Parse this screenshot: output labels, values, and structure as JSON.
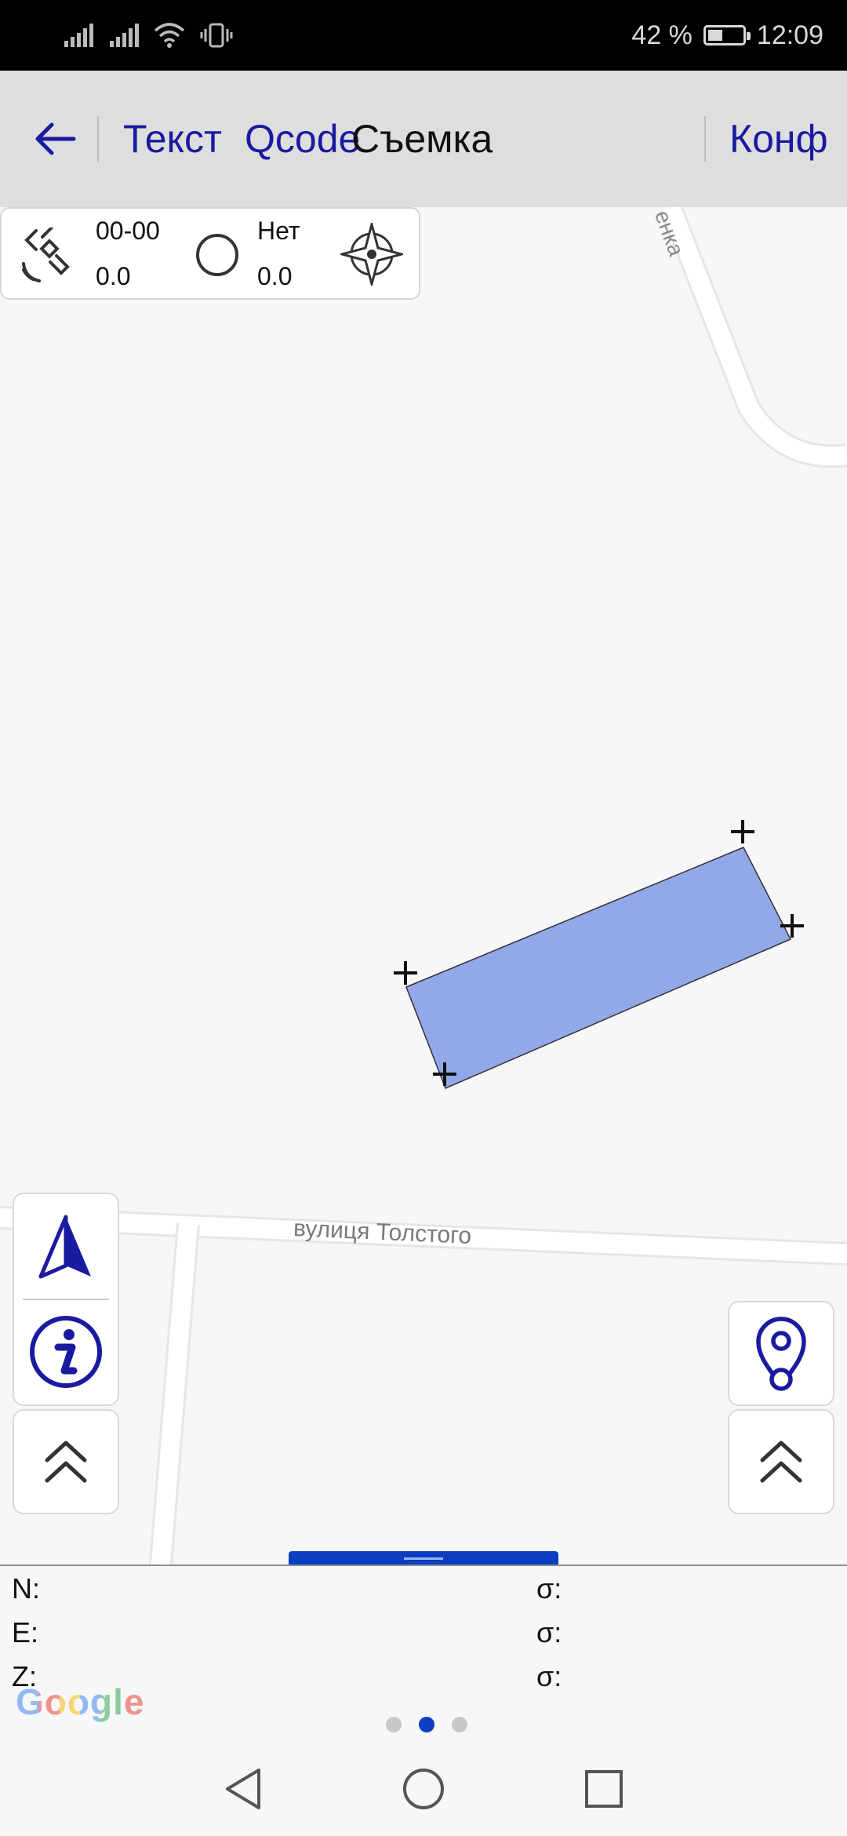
{
  "status_bar": {
    "battery_percent": "42 %",
    "battery_level": 0.42,
    "time": "12:09"
  },
  "toolbar": {
    "back_icon": "arrow-left-icon",
    "tab_text": "Текст",
    "tab_qcode": "Qcode",
    "title": "Съемка",
    "config": "Конф"
  },
  "gps": {
    "satellite_icon": "satellite-icon",
    "time_value": "00-00",
    "value_1": "0.0",
    "fix_icon": "circle-icon",
    "fix_status": "Нет",
    "value_2": "0.0",
    "compass_icon": "compass-icon"
  },
  "map": {
    "road_top_label": "енка",
    "street_label": "вулиця Толстого",
    "polygon_color": "#93a8e8",
    "google_logo": "Google"
  },
  "buttons": {
    "navigate_icon": "navigation-arrow-icon",
    "info_icon": "info-icon",
    "expand_left_icon": "chevron-up-double-icon",
    "location_pin_icon": "location-pin-icon",
    "expand_right_icon": "chevron-up-double-icon"
  },
  "readout": {
    "n_label": "N:",
    "e_label": "E:",
    "z_label": "Z:",
    "sigma_n": "σ:",
    "sigma_e": "σ:",
    "sigma_z": "σ:"
  },
  "pager": {
    "active_index": 1,
    "count": 3
  },
  "colors": {
    "accent": "#1a1aa0",
    "panel_handle": "#0b3fbf"
  }
}
